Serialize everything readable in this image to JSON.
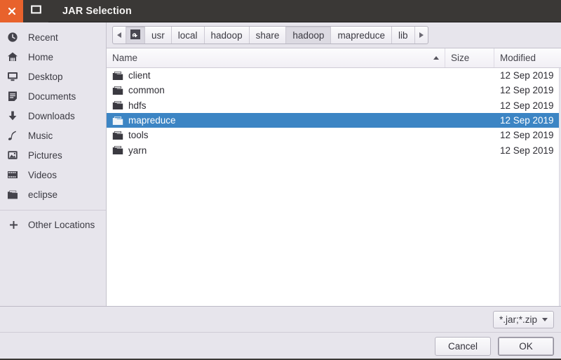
{
  "window": {
    "title": "JAR Selection",
    "close_icon": "close-icon",
    "maximize_icon": "maximize-icon",
    "accent_orange": "#e8622c",
    "titlebar_bg": "#3a3836",
    "selection_blue": "#3c85c4"
  },
  "sidebar": {
    "items": [
      {
        "label": "Recent",
        "icon": "clock-icon"
      },
      {
        "label": "Home",
        "icon": "home-icon"
      },
      {
        "label": "Desktop",
        "icon": "monitor-icon"
      },
      {
        "label": "Documents",
        "icon": "document-icon"
      },
      {
        "label": "Downloads",
        "icon": "download-arrow-icon"
      },
      {
        "label": "Music",
        "icon": "music-note-icon"
      },
      {
        "label": "Pictures",
        "icon": "picture-icon"
      },
      {
        "label": "Videos",
        "icon": "film-icon"
      },
      {
        "label": "eclipse",
        "icon": "folder-icon"
      }
    ],
    "other_locations": {
      "label": "Other Locations",
      "icon": "plus-icon"
    }
  },
  "pathbar": {
    "prev_icon": "chevron-left-icon",
    "next_icon": "chevron-right-icon",
    "disk_icon": "filesystem-icon",
    "crumbs": [
      {
        "label": "usr",
        "active": false
      },
      {
        "label": "local",
        "active": false
      },
      {
        "label": "hadoop",
        "active": false
      },
      {
        "label": "share",
        "active": false
      },
      {
        "label": "hadoop",
        "active": true
      },
      {
        "label": "mapreduce",
        "active": false
      },
      {
        "label": "lib",
        "active": false
      }
    ]
  },
  "filelist": {
    "columns": {
      "name": "Name",
      "size": "Size",
      "modified": "Modified"
    },
    "sort": {
      "column": "Name",
      "direction": "ascending",
      "icon": "sort-ascending-icon"
    },
    "rows": [
      {
        "name": "client",
        "size": "",
        "modified": "12 Sep 2019",
        "icon": "folder-icon",
        "selected": false
      },
      {
        "name": "common",
        "size": "",
        "modified": "12 Sep 2019",
        "icon": "folder-icon",
        "selected": false
      },
      {
        "name": "hdfs",
        "size": "",
        "modified": "12 Sep 2019",
        "icon": "folder-icon",
        "selected": false
      },
      {
        "name": "mapreduce",
        "size": "",
        "modified": "12 Sep 2019",
        "icon": "folder-icon",
        "selected": true
      },
      {
        "name": "tools",
        "size": "",
        "modified": "12 Sep 2019",
        "icon": "folder-icon",
        "selected": false
      },
      {
        "name": "yarn",
        "size": "",
        "modified": "12 Sep 2019",
        "icon": "folder-icon",
        "selected": false
      }
    ]
  },
  "filter": {
    "value": "*.jar;*.zip",
    "caret_icon": "chevron-down-icon"
  },
  "actions": {
    "cancel_label": "Cancel",
    "ok_label": "OK",
    "focused": "OK"
  }
}
